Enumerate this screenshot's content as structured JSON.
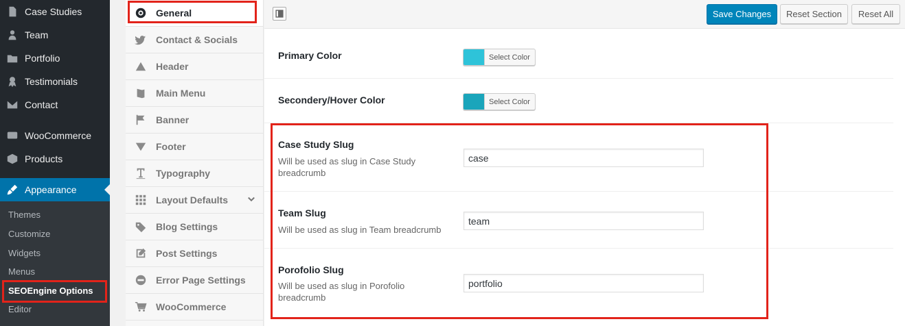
{
  "wp_sidebar": {
    "items": [
      {
        "label": "Case Studies",
        "icon": "document-icon"
      },
      {
        "label": "Team",
        "icon": "person-icon"
      },
      {
        "label": "Portfolio",
        "icon": "folder-icon"
      },
      {
        "label": "Testimonials",
        "icon": "award-icon"
      },
      {
        "label": "Contact",
        "icon": "mail-icon"
      },
      {
        "label": "WooCommerce",
        "icon": "woo-icon"
      },
      {
        "label": "Products",
        "icon": "box-icon"
      },
      {
        "label": "Appearance",
        "icon": "paintbrush-icon"
      }
    ],
    "submenu": [
      "Themes",
      "Customize",
      "Widgets",
      "Menus",
      "SEOEngine Options",
      "Editor"
    ],
    "current_submenu": "SEOEngine Options"
  },
  "options_nav": {
    "items": [
      {
        "label": "General",
        "icon": "globe-icon"
      },
      {
        "label": "Contact & Socials",
        "icon": "twitter-icon"
      },
      {
        "label": "Header",
        "icon": "triangle-up-icon"
      },
      {
        "label": "Main Menu",
        "icon": "book-icon"
      },
      {
        "label": "Banner",
        "icon": "flag-icon"
      },
      {
        "label": "Footer",
        "icon": "triangle-down-icon"
      },
      {
        "label": "Typography",
        "icon": "text-icon"
      },
      {
        "label": "Layout Defaults",
        "icon": "grid-icon"
      },
      {
        "label": "Blog Settings",
        "icon": "tags-icon"
      },
      {
        "label": "Post Settings",
        "icon": "edit-icon"
      },
      {
        "label": "Error Page Settings",
        "icon": "minus-circle-icon"
      },
      {
        "label": "WooCommerce",
        "icon": "cart-icon"
      }
    ],
    "active": "General"
  },
  "toolbar": {
    "save_label": "Save Changes",
    "reset_section_label": "Reset Section",
    "reset_all_label": "Reset All"
  },
  "settings": {
    "primary_color": {
      "label": "Primary Color",
      "button_label": "Select Color",
      "value": "#2ec3d9"
    },
    "hover_color": {
      "label": "Secondery/Hover Color",
      "button_label": "Select Color",
      "value": "#1aa5bb"
    },
    "case_study_slug": {
      "label": "Case Study Slug",
      "description": "Will be used as slug in Case Study breadcrumb",
      "value": "case"
    },
    "team_slug": {
      "label": "Team Slug",
      "description": "Will be used as slug in Team breadcrumb",
      "value": "team"
    },
    "portfolio_slug": {
      "label": "Porofolio Slug",
      "description": "Will be used as slug in Porofolio breadcrumb",
      "value": "portfolio"
    }
  },
  "colors": {
    "wp_sidebar_bg": "#23282d",
    "wp_active": "#0073aa",
    "primary_button": "#0085ba",
    "highlight_red": "#e2231a"
  }
}
